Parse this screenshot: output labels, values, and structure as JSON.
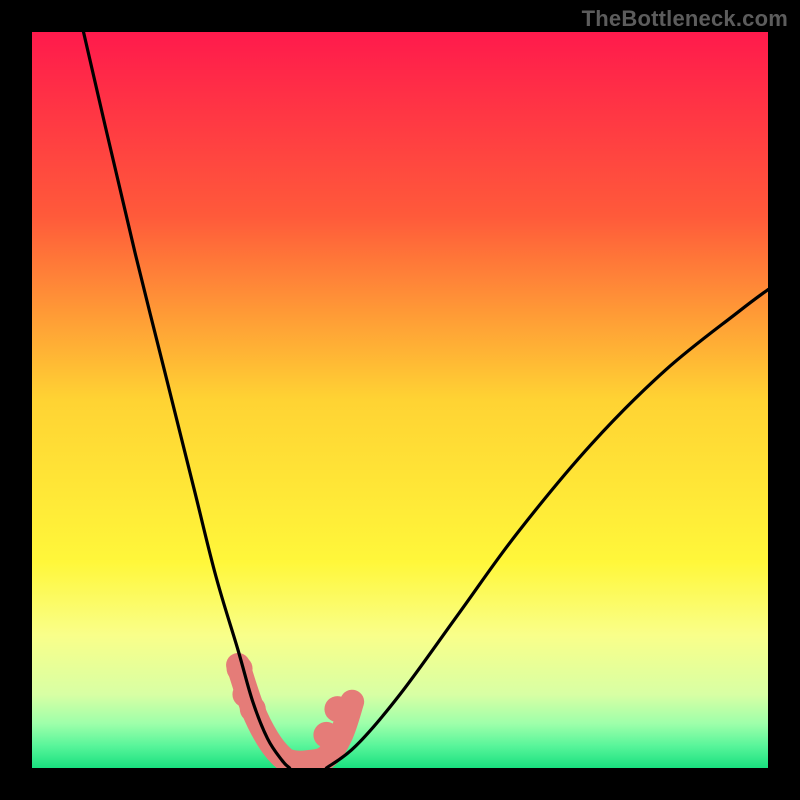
{
  "watermark": "TheBottleneck.com",
  "chart_data": {
    "type": "line",
    "title": "",
    "xlabel": "",
    "ylabel": "",
    "xlim": [
      0,
      100
    ],
    "ylim": [
      0,
      100
    ],
    "grid": false,
    "legend": false,
    "gradient_stops": [
      {
        "offset": 0.0,
        "color": "#ff1a4c"
      },
      {
        "offset": 0.25,
        "color": "#ff5a3a"
      },
      {
        "offset": 0.5,
        "color": "#ffd333"
      },
      {
        "offset": 0.72,
        "color": "#fff73a"
      },
      {
        "offset": 0.82,
        "color": "#f9ff8a"
      },
      {
        "offset": 0.9,
        "color": "#d8ffa4"
      },
      {
        "offset": 0.94,
        "color": "#9dffaa"
      },
      {
        "offset": 0.97,
        "color": "#58f59a"
      },
      {
        "offset": 1.0,
        "color": "#19e07f"
      }
    ],
    "series": [
      {
        "name": "left-curve",
        "x": [
          7,
          10,
          14,
          18,
          22,
          25,
          28,
          30,
          32,
          34,
          35
        ],
        "y": [
          100,
          87,
          70,
          54,
          38,
          26,
          16,
          9,
          4,
          1,
          0
        ]
      },
      {
        "name": "right-curve",
        "x": [
          40,
          44,
          50,
          58,
          66,
          76,
          86,
          96,
          100
        ],
        "y": [
          0,
          3,
          10,
          21,
          32,
          44,
          54,
          62,
          65
        ]
      }
    ],
    "valley_band": {
      "x": [
        28,
        30,
        32,
        34,
        35.5,
        37.5,
        40,
        42,
        43.5
      ],
      "y": [
        14,
        8,
        4,
        1.5,
        0.8,
        0.8,
        1.5,
        4.5,
        9
      ],
      "points": [
        {
          "x": 28.2,
          "y": 13.5
        },
        {
          "x": 29.0,
          "y": 10.0
        },
        {
          "x": 30.0,
          "y": 8.0
        },
        {
          "x": 40.0,
          "y": 4.5
        },
        {
          "x": 41.5,
          "y": 8.0
        }
      ]
    }
  }
}
